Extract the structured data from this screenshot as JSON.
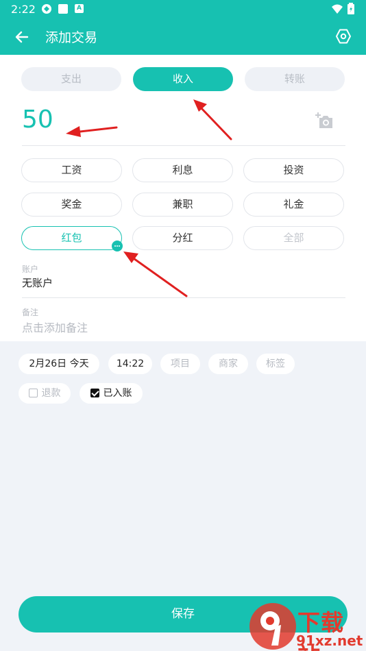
{
  "status_bar": {
    "time": "2:22",
    "app_icon_label": "A"
  },
  "app_bar": {
    "title": "添加交易"
  },
  "type_tabs": [
    {
      "label": "支出",
      "selected": false
    },
    {
      "label": "收入",
      "selected": true
    },
    {
      "label": "转账",
      "selected": false
    }
  ],
  "amount": "50",
  "categories": [
    {
      "label": "工资"
    },
    {
      "label": "利息"
    },
    {
      "label": "投资"
    },
    {
      "label": "奖金"
    },
    {
      "label": "兼职"
    },
    {
      "label": "礼金"
    },
    {
      "label": "红包",
      "selected": true
    },
    {
      "label": "分红"
    },
    {
      "label": "全部"
    }
  ],
  "account": {
    "label": "账户",
    "value": "无账户"
  },
  "note": {
    "label": "备注",
    "placeholder": "点击添加备注"
  },
  "meta": {
    "date": "2月26日  今天",
    "time": "14:22",
    "project": "项目",
    "merchant": "商家",
    "tag": "标签"
  },
  "flags": {
    "refund": {
      "label": "退款",
      "checked": false
    },
    "posted": {
      "label": "已入账",
      "checked": true
    }
  },
  "save_label": "保存",
  "watermark": {
    "text": "下载站",
    "url": "91xz.net"
  },
  "colors": {
    "accent": "#17c1b1",
    "annotation": "#e02020"
  }
}
